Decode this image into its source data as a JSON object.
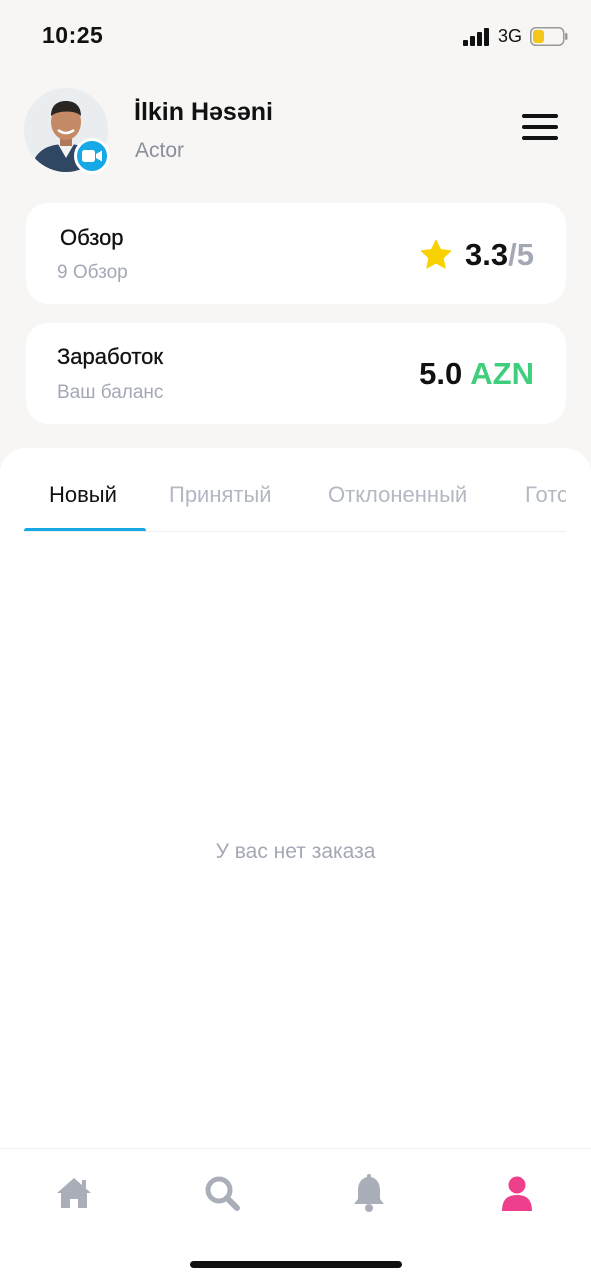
{
  "status_bar": {
    "time": "10:25",
    "network": "3G",
    "battery_color": "#f5c518"
  },
  "profile": {
    "name": "İlkin Həsəni",
    "role": "Actor",
    "badge_icon": "video-camera-icon",
    "badge_color": "#17a9e6"
  },
  "review_card": {
    "title": "Обзор",
    "subtitle": "9 Обзор",
    "rating": "3.3",
    "rating_max": "/5",
    "star_color": "#f7d100"
  },
  "earnings_card": {
    "title": "Заработок",
    "subtitle": "Ваш баланс",
    "amount": "5.0",
    "currency": "AZN",
    "currency_color": "#3fcf7c"
  },
  "tabs": [
    {
      "label": "Новый",
      "active": true
    },
    {
      "label": "Принятый",
      "active": false
    },
    {
      "label": "Отклоненный",
      "active": false
    },
    {
      "label": "Готово",
      "active": false
    }
  ],
  "empty_state": {
    "text": "У вас нет заказа"
  },
  "bottom_nav": [
    {
      "icon": "home-icon",
      "active": false
    },
    {
      "icon": "search-icon",
      "active": false
    },
    {
      "icon": "bell-icon",
      "active": false
    },
    {
      "icon": "user-icon",
      "active": true
    }
  ],
  "colors": {
    "accent": "#17a9e6",
    "nav_active": "#ee3f8c",
    "nav_inactive": "#a9aeb9"
  }
}
